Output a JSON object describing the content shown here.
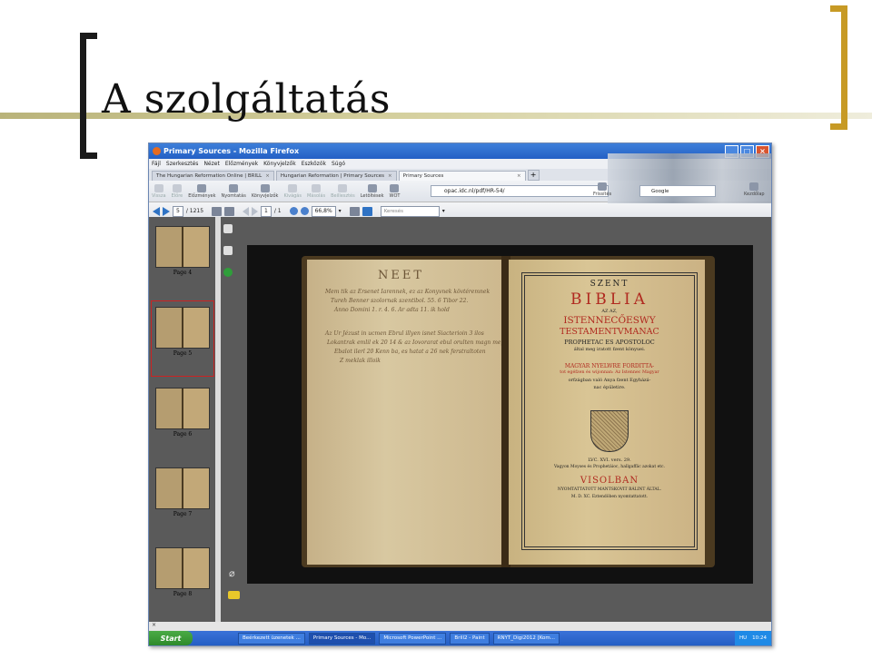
{
  "slide": {
    "title": "A szolgáltatás"
  },
  "window": {
    "title": "Primary Sources - Mozilla Firefox",
    "menu": [
      "Fájl",
      "Szerkesztés",
      "Nézet",
      "Előzmények",
      "Könyvjelzők",
      "Eszközök",
      "Súgó"
    ],
    "tabs": [
      {
        "label": "The Hungarian Reformation Online | BRILL"
      },
      {
        "label": "Hungarian Reformation | Primary Sources"
      },
      {
        "label": "Primary Sources"
      }
    ],
    "nav_buttons": [
      "Vissza",
      "Előre",
      "Előzmények",
      "Nyomtatás",
      "Könyvjelzők",
      "Kivágás",
      "Másolás",
      "Beillesztés",
      "Letöltések",
      "WOT"
    ],
    "url": "opac.idc.nl/pdf/HR-54/",
    "refresh_label": "Frissítés",
    "search_engine": "Google",
    "home_label": "Kezdőlap"
  },
  "pdf": {
    "current_page": "5",
    "total_pages": "/ 1215",
    "view_page": "1",
    "view_total": "/ 1",
    "zoom": "66,8%",
    "search_placeholder": "Keresés",
    "thumbnails": [
      "Page 4",
      "Page 5",
      "Page 6",
      "Page 7",
      "Page 8"
    ]
  },
  "book": {
    "left_heading": "NEET",
    "left_lines": [
      "Mem tik az Ersenet Iarennek, ez az Konyvnek kövtéremnek",
      "Tureh Benner szolornak szentibol. 55. 6 Tibor 22.",
      "Anno Domini 1. r. 4. 6. Ar adta 11. ik hold",
      "Az Ur Jézust in ucmen Ebrul illyen isnet Siacterioin 3 ilos",
      "Lokantrak emlil ek 20 14 & az Iovorarat ebul orulten magn meglin",
      "Ebalot ilerl 20 Kenn ba, es hatat a 26 nek ferstraltoten",
      "Z meklak illoik"
    ],
    "title_page": {
      "szent": "SZENT",
      "biblia": "BIBLIA",
      "az_az": "AZ AZ,",
      "line1": "ISTENNECŐESWY",
      "line2": "TESTAMENTVMANAC",
      "line3": "PROPHETAC ES APOSTOLOC",
      "line4": "által meg iratott fzent könyuei.",
      "line5": "MAGYAR NYELWRE FORDITTA-",
      "line6": "tot egéfzen és wijonnan: Az Istennec Magyar",
      "line7": "orfzágban való Anya fzent Egyházá-",
      "line8": "nac épületire.",
      "line9": "LVC. XVI. vers. 29.",
      "line10": "Vagyon Moyses és Prophetáioc, hallgaffäc azokat etc.",
      "visol": "VISOLBAN",
      "line11": "NYOMTATTATOTT MANTSKOVIT BÁLINT ÁLTAL.",
      "line12": "M. D. XC. Eztendöben nyomtattatott."
    }
  },
  "taskbar": {
    "start": "Start",
    "tasks": [
      "Beérkezett üzenetek ...",
      "Primary Sources - Mo...",
      "Microsoft PowerPoint ...",
      "Brill2 - Paint",
      "RNYT_Digi2012 [Kom..."
    ],
    "lang": "HU",
    "clock": "10:24"
  },
  "status_close": "×"
}
